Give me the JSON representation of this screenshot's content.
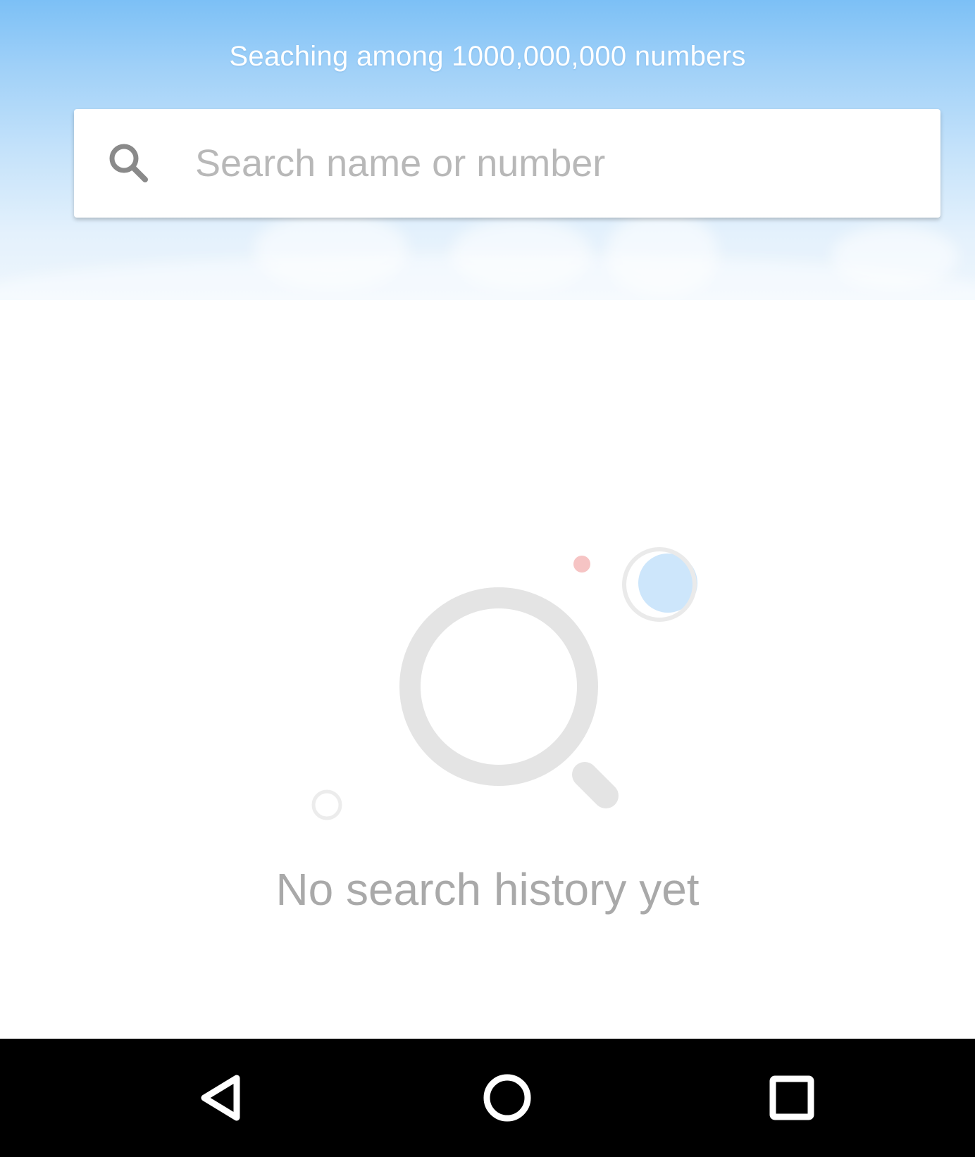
{
  "header": {
    "title": "Seaching among 1000,000,000 numbers"
  },
  "search": {
    "placeholder": "Search name or number",
    "value": "",
    "icon": "search-icon"
  },
  "empty_state": {
    "message": "No search history yet",
    "illustration": "magnifier-illustration"
  },
  "navbar": {
    "back_icon": "back-triangle-icon",
    "home_icon": "home-circle-icon",
    "recent_icon": "recent-apps-square-icon"
  },
  "colors": {
    "header_top": "#7cc0f6",
    "header_bottom": "#eef6fd",
    "placeholder": "#b8b8b8",
    "empty_text": "#a9a9a9",
    "illustration_gray": "#e4e4e4",
    "accent_pink": "#f6c4c4",
    "accent_blue": "#cde6fb",
    "navbar": "#000000"
  }
}
